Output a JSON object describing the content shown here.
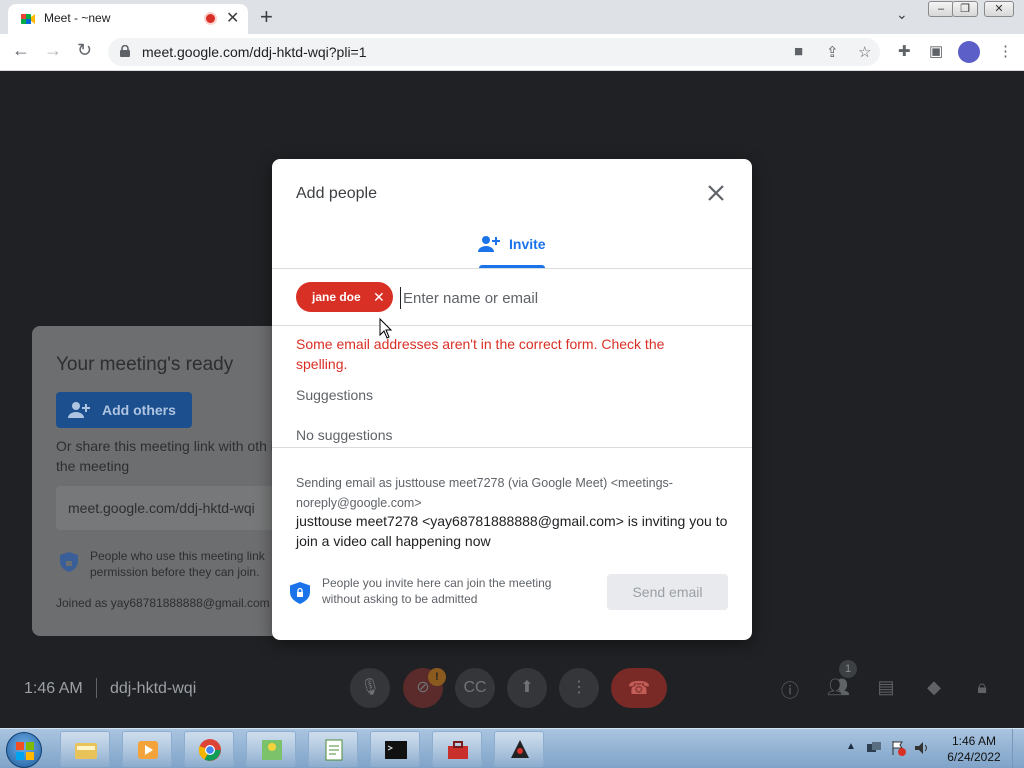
{
  "browser": {
    "tab_title": "Meet - ~new",
    "url": "meet.google.com/ddj-hktd-wqi?pli=1"
  },
  "meet": {
    "ready_title": "Your meeting's ready",
    "add_others_label": "Add others",
    "share_text": "Or share this meeting link with oth in the meeting",
    "meeting_link": "meet.google.com/ddj-hktd-wqi",
    "permission_text": "People who use this meeting link permission before they can join.",
    "joined_as": "Joined as yay68781888888@gmail.com",
    "time": "1:46 AM",
    "meeting_code": "ddj-hktd-wqi",
    "people_count": "1",
    "alert_badge": "!"
  },
  "dialog": {
    "title": "Add people",
    "tab_label": "Invite",
    "chip_label": "jane doe",
    "input_placeholder": "Enter name or email",
    "error_text": "Some email addresses aren't in the correct form. Check the spelling.",
    "suggestions_title": "Suggestions",
    "no_suggestions": "No suggestions",
    "sending_as": "Sending email as justtouse meet7278 (via Google Meet) <meetings-noreply@google.com>",
    "inviting_text": "justtouse meet7278 <yay68781888888@gmail.com> is inviting you to join a video call happening now",
    "admit_text": "People you invite here can join the meeting without asking to be admitted",
    "send_button": "Send email"
  },
  "taskbar": {
    "clock_time": "1:46 AM",
    "clock_date": "6/24/2022"
  },
  "colors": {
    "accent": "#1a73e8",
    "error": "#d93025",
    "meet_bg": "#202124"
  }
}
